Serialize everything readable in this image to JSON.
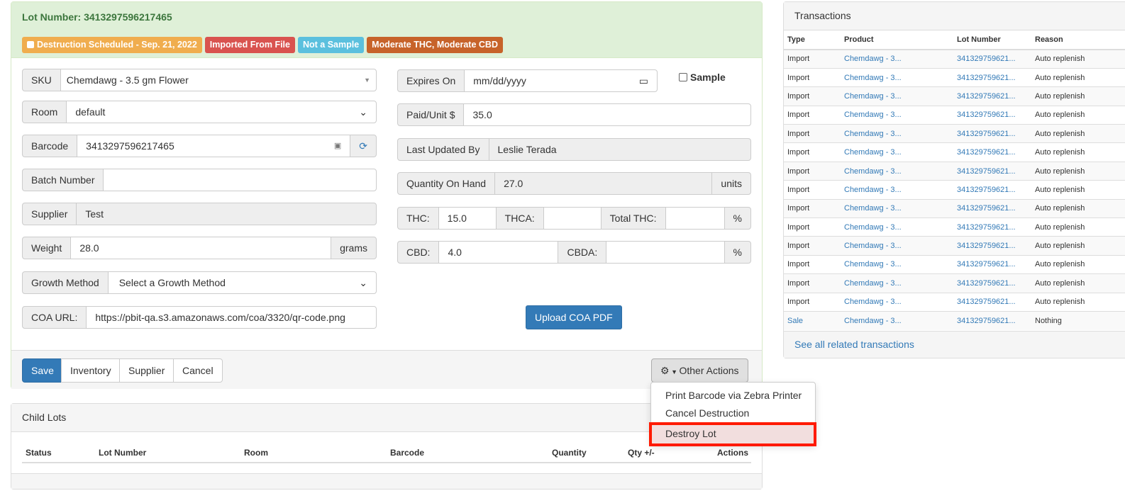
{
  "lot": {
    "title": "Lot Number: 3413297596217465",
    "badges": [
      {
        "label": "Destruction Scheduled - Sep. 21, 2022",
        "color": "#f0ad4e"
      },
      {
        "label": "Imported From File",
        "color": "#d9534f"
      },
      {
        "label": "Not a Sample",
        "color": "#5bc0de"
      },
      {
        "label": "Moderate THC, Moderate CBD",
        "color": "#c7632a"
      }
    ],
    "sku": {
      "label": "SKU",
      "value": "Chemdawg - 3.5 gm Flower"
    },
    "room": {
      "label": "Room",
      "value": "default"
    },
    "barcode": {
      "label": "Barcode",
      "value": "3413297596217465"
    },
    "batch": {
      "label": "Batch Number",
      "value": ""
    },
    "supplier": {
      "label": "Supplier",
      "value": "Test"
    },
    "weight": {
      "label": "Weight",
      "value": "28.0",
      "unit": "grams"
    },
    "growth": {
      "label": "Growth Method",
      "value": "Select a Growth Method"
    },
    "coa": {
      "label": "COA URL:",
      "value": "https://pbit-qa.s3.amazonaws.com/coa/3320/qr-code.png"
    },
    "expires": {
      "label": "Expires On",
      "placeholder": "mm/dd/yyyy"
    },
    "sample": {
      "label": "Sample",
      "checked": false
    },
    "paid": {
      "label": "Paid/Unit $",
      "value": "35.0"
    },
    "updated": {
      "label": "Last Updated By",
      "value": "Leslie Terada"
    },
    "qoh": {
      "label": "Quantity On Hand",
      "value": "27.0",
      "unit": "units"
    },
    "thc": {
      "label": "THC:",
      "value": "15.0",
      "thca_label": "THCA:",
      "thca": "",
      "total_label": "Total THC:",
      "total": "",
      "unit": "%"
    },
    "cbd": {
      "label": "CBD:",
      "value": "4.0",
      "cbda_label": "CBDA:",
      "cbda": "",
      "unit": "%"
    },
    "upload": "Upload COA PDF",
    "buttons": {
      "save": "Save",
      "inventory": "Inventory",
      "supplier": "Supplier",
      "cancel": "Cancel",
      "other": "Other Actions"
    },
    "menu": [
      "Print Barcode via Zebra Printer",
      "Cancel Destruction",
      "Destroy Lot"
    ]
  },
  "child": {
    "title": "Child Lots",
    "columns": [
      "Status",
      "Lot Number",
      "Room",
      "Barcode",
      "Quantity",
      "Qty +/-",
      "Actions"
    ]
  },
  "transactions": {
    "title": "Transactions",
    "columns": [
      "Type",
      "Product",
      "Lot Number",
      "Reason"
    ],
    "rows": [
      [
        "Import",
        "Chemdawg - 3...",
        "341329759621...",
        "Auto replenish"
      ],
      [
        "Import",
        "Chemdawg - 3...",
        "341329759621...",
        "Auto replenish"
      ],
      [
        "Import",
        "Chemdawg - 3...",
        "341329759621...",
        "Auto replenish"
      ],
      [
        "Import",
        "Chemdawg - 3...",
        "341329759621...",
        "Auto replenish"
      ],
      [
        "Import",
        "Chemdawg - 3...",
        "341329759621...",
        "Auto replenish"
      ],
      [
        "Import",
        "Chemdawg - 3...",
        "341329759621...",
        "Auto replenish"
      ],
      [
        "Import",
        "Chemdawg - 3...",
        "341329759621...",
        "Auto replenish"
      ],
      [
        "Import",
        "Chemdawg - 3...",
        "341329759621...",
        "Auto replenish"
      ],
      [
        "Import",
        "Chemdawg - 3...",
        "341329759621...",
        "Auto replenish"
      ],
      [
        "Import",
        "Chemdawg - 3...",
        "341329759621...",
        "Auto replenish"
      ],
      [
        "Import",
        "Chemdawg - 3...",
        "341329759621...",
        "Auto replenish"
      ],
      [
        "Import",
        "Chemdawg - 3...",
        "341329759621...",
        "Auto replenish"
      ],
      [
        "Import",
        "Chemdawg - 3...",
        "341329759621...",
        "Auto replenish"
      ],
      [
        "Import",
        "Chemdawg - 3...",
        "341329759621...",
        "Auto replenish"
      ],
      [
        "Sale",
        "Chemdawg - 3...",
        "341329759621...",
        "Nothing"
      ]
    ],
    "see_all": "See all related transactions"
  }
}
